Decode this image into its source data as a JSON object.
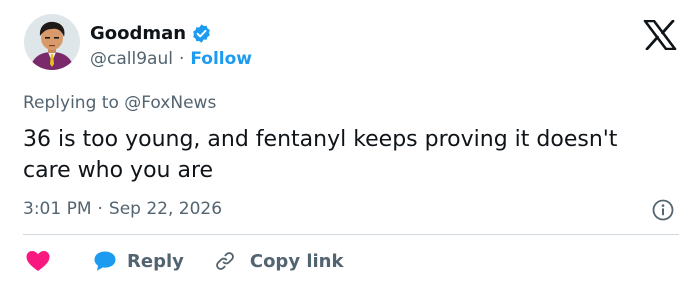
{
  "author": {
    "display_name": "Goodman",
    "handle": "@call9aul",
    "follow_label": "Follow",
    "verified": true,
    "dot": "·"
  },
  "reply_context": {
    "prefix": "Replying to ",
    "mention": "@FoxNews"
  },
  "tweet": {
    "text": "36 is too young, and fentanyl keeps proving it doesn't care who you are",
    "time": "3:01 PM",
    "date": "Sep 22, 2026",
    "sep": "·"
  },
  "actions": {
    "reply_label": "Reply",
    "copy_label": "Copy link"
  },
  "icons": {
    "verified": "verified-badge-icon",
    "brand": "x-logo-icon",
    "info": "info-icon",
    "like": "heart-icon",
    "reply": "reply-bubble-icon",
    "copy": "link-icon"
  },
  "colors": {
    "accent": "#1d9bf0",
    "like": "#f91880",
    "muted": "#536471",
    "text": "#0f1419",
    "divider": "#cfd9de"
  }
}
